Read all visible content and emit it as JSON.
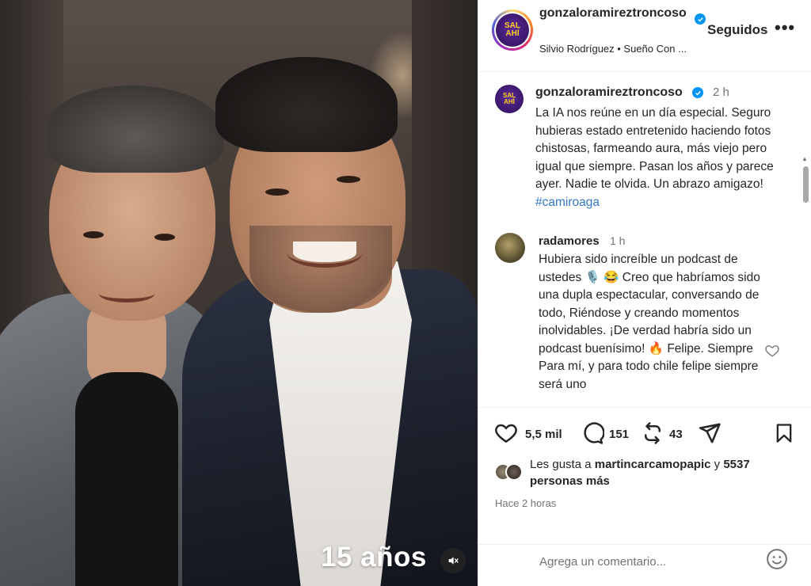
{
  "media": {
    "caption": "15 años",
    "mute_icon": "speaker-muted-icon"
  },
  "header": {
    "username": "gonzaloramireztroncoso",
    "avatar_text": [
      "SAL",
      "AHÍ"
    ],
    "follow_label": "Seguidos",
    "more_label": "•••",
    "audio": "Silvio Rodríguez • Sueño Con ..."
  },
  "post_caption": {
    "username": "gonzaloramireztroncoso",
    "time": "2 h",
    "text": "La IA nos reúne en  un día especial. Seguro hubieras estado entretenido haciendo fotos chistosas, farmeando aura, más viejo pero igual que siempre. Pasan los años y parece ayer. Nadie te olvida. Un abrazo amigazo!",
    "hashtag": "#camiroaga"
  },
  "comment": {
    "username": "radamores",
    "time": "1 h",
    "text": "Hubiera sido increíble un podcast de ustedes 🎙️ 😂 Creo que habríamos sido una dupla espectacular, conversando de todo, Riéndose y creando momentos inolvidables. ¡De verdad habría sido un podcast buenísimo! 🔥 Felipe. Siempre Para mí, y para todo chile felipe siempre será uno"
  },
  "actions": {
    "likes_count": "5,5 mil",
    "comments_count": "151",
    "reposts_count": "43"
  },
  "likes": {
    "prefix": "Les gusta a",
    "user": "martincarcamopapic",
    "connector": "y",
    "others": "5537 personas más"
  },
  "timestamp": "Hace 2 horas",
  "comment_input": {
    "placeholder": "Agrega un comentario..."
  },
  "colors": {
    "verified": "#0095f6",
    "hashtag": "#3478c6",
    "secondary_text": "#737373"
  }
}
